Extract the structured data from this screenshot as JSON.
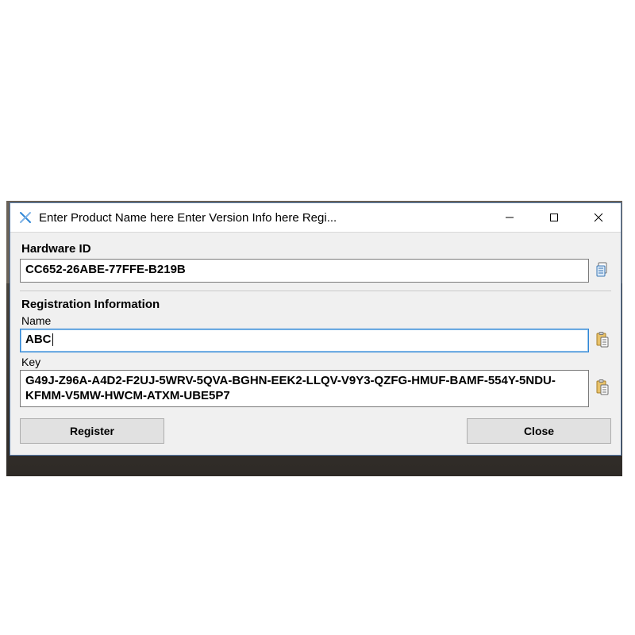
{
  "titlebar": {
    "title": "Enter Product Name here Enter Version Info here Regi..."
  },
  "hardware": {
    "label": "Hardware ID",
    "value": "CC652-26ABE-77FFE-B219B"
  },
  "registration": {
    "label": "Registration Information",
    "name_label": "Name",
    "name_value": "ABC",
    "key_label": "Key",
    "key_value": "G49J-Z96A-A4D2-F2UJ-5WRV-5QVA-BGHN-EEK2-LLQV-V9Y3-QZFG-HMUF-BAMF-554Y-5NDU-KFMM-V5MW-HWCM-ATXM-UBE5P7"
  },
  "buttons": {
    "register": "Register",
    "close": "Close"
  }
}
